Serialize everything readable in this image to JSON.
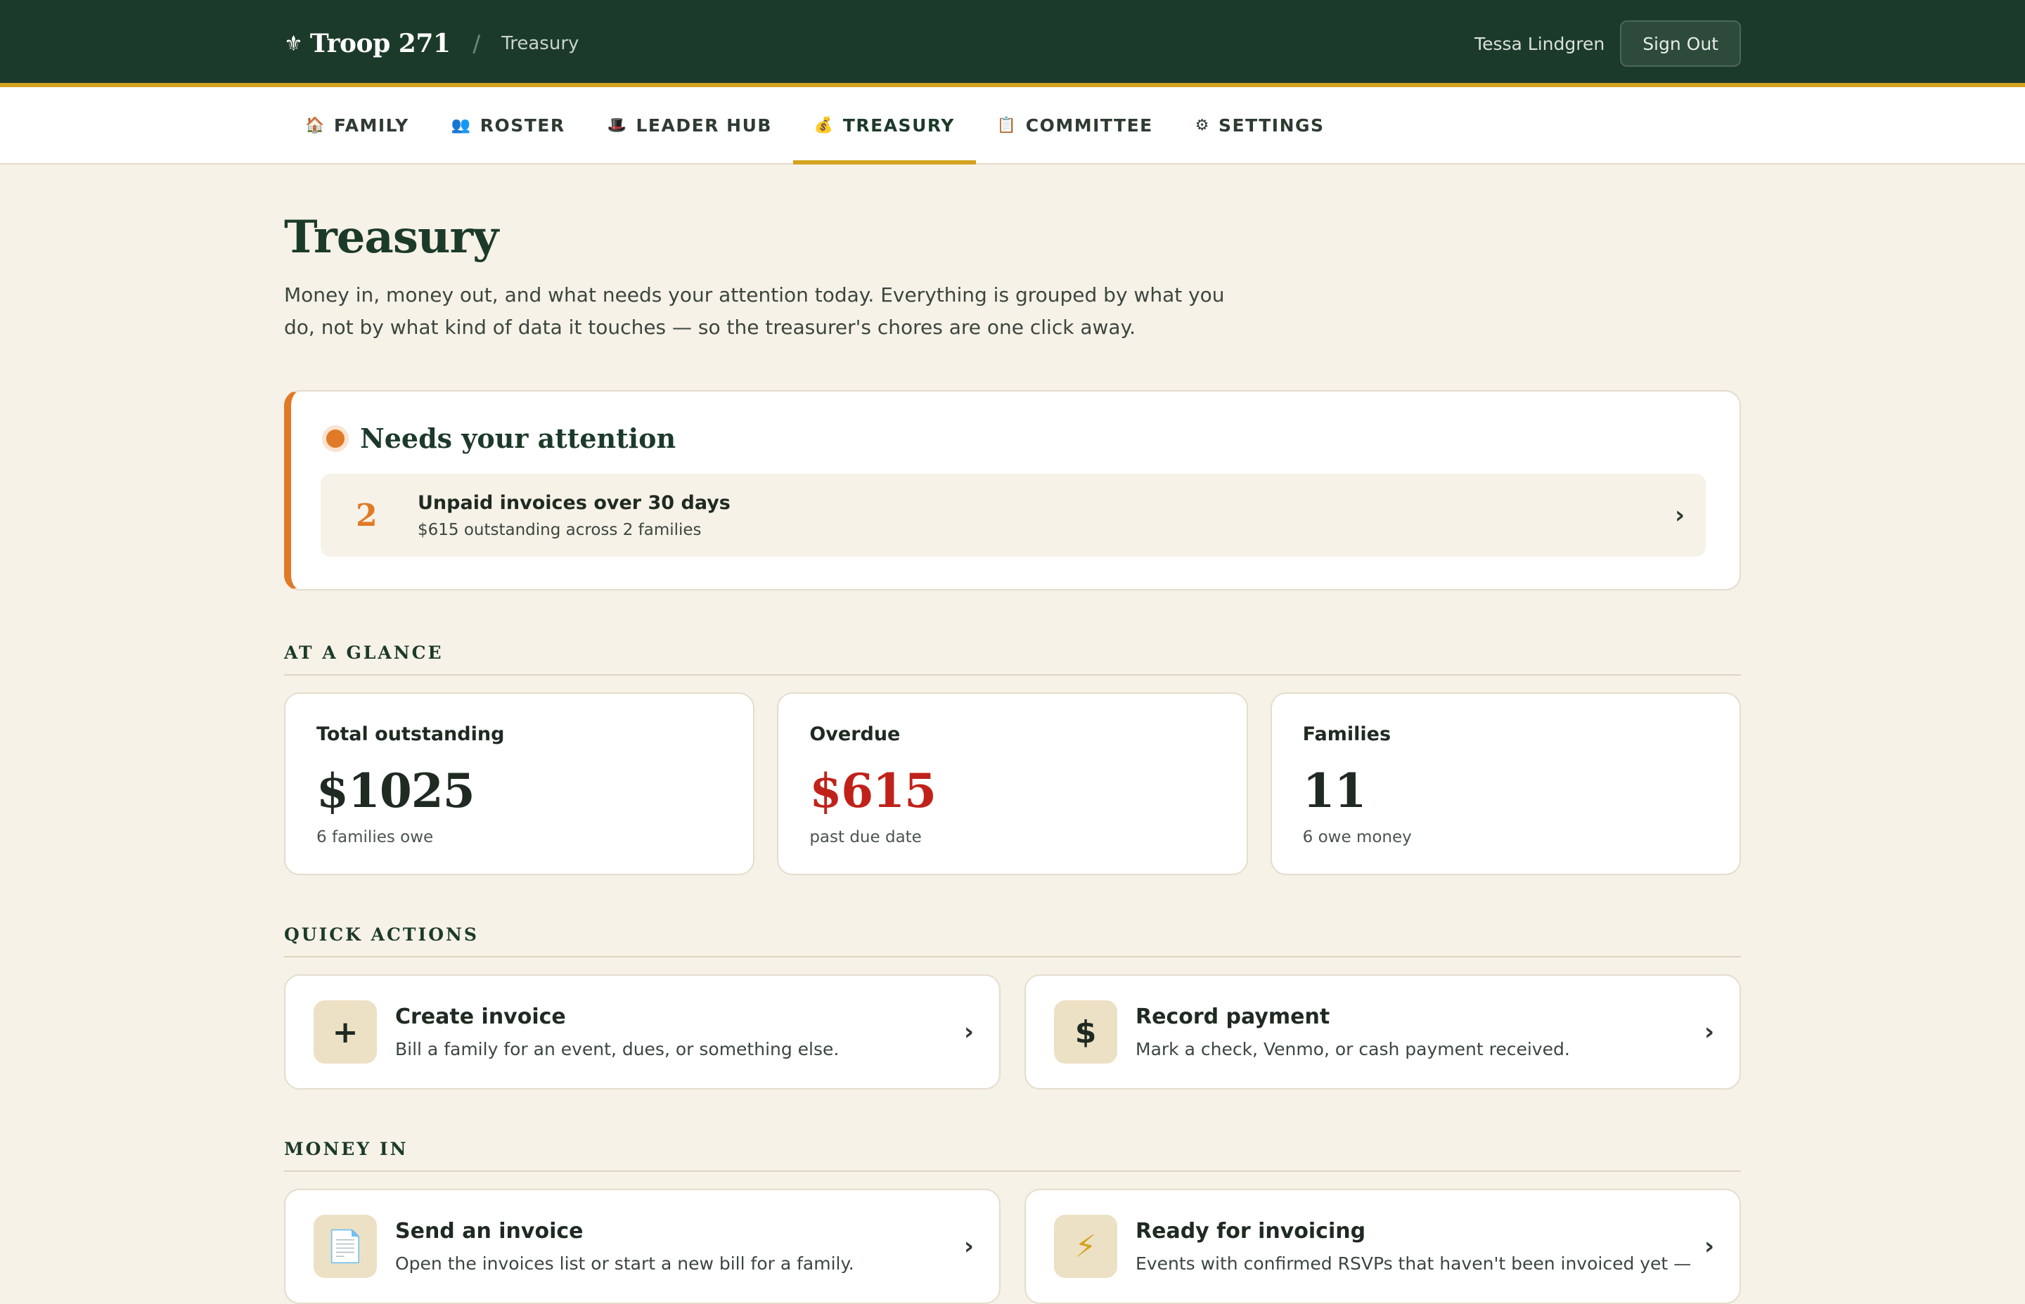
{
  "header": {
    "brand_icon": "⚜",
    "brand_name": "Troop 271",
    "separator": "/",
    "breadcrumb": "Treasury",
    "user_name": "Tessa Lindgren",
    "sign_out_label": "Sign Out"
  },
  "nav": {
    "tabs": [
      {
        "icon": "🏠",
        "label": "FAMILY"
      },
      {
        "icon": "👥",
        "label": "ROSTER"
      },
      {
        "icon": "🎩",
        "label": "LEADER HUB"
      },
      {
        "icon": "💰",
        "label": "TREASURY"
      },
      {
        "icon": "📋",
        "label": "COMMITTEE"
      },
      {
        "icon": "⚙",
        "label": "SETTINGS"
      }
    ],
    "active": "TREASURY"
  },
  "page": {
    "title": "Treasury",
    "description": "Money in, money out, and what needs your attention today. Everything is grouped by what you do, not by what kind of data it touches — so the treasurer's chores are one click away."
  },
  "attention": {
    "title": "Needs your attention",
    "items": [
      {
        "count": "2",
        "title": "Unpaid invoices over 30 days",
        "subtitle": "$615 outstanding across 2 families",
        "chevron": "›"
      }
    ]
  },
  "at_a_glance": {
    "label": "AT A GLANCE",
    "stats": [
      {
        "label": "Total outstanding",
        "value": "$1025",
        "sub": "6 families owe"
      },
      {
        "label": "Overdue",
        "value": "$615",
        "sub": "past due date"
      },
      {
        "label": "Families",
        "value": "11",
        "sub": "6 owe money"
      }
    ]
  },
  "quick_actions": {
    "label": "QUICK ACTIONS",
    "items": [
      {
        "icon": "+",
        "title": "Create invoice",
        "subtitle": "Bill a family for an event, dues, or something else.",
        "chevron": "›"
      },
      {
        "icon": "$",
        "title": "Record payment",
        "subtitle": "Mark a check, Venmo, or cash payment received.",
        "chevron": "›"
      }
    ]
  },
  "money_in": {
    "label": "MONEY IN",
    "items": [
      {
        "icon": "📄",
        "title": "Send an invoice",
        "subtitle": "Open the invoices list or start a new bill for a family.",
        "chevron": "›"
      },
      {
        "icon": "⚡",
        "title": "Ready for invoicing",
        "subtitle": "Events with confirmed RSVPs that haven't been invoiced yet —",
        "chevron": "›"
      }
    ]
  },
  "colors": {
    "header_bg": "#1c3a2a",
    "accent_gold": "#d4a21f",
    "attention_orange": "#e07a26",
    "overdue_red": "#c0221a",
    "page_bg": "#f6f2e8"
  }
}
